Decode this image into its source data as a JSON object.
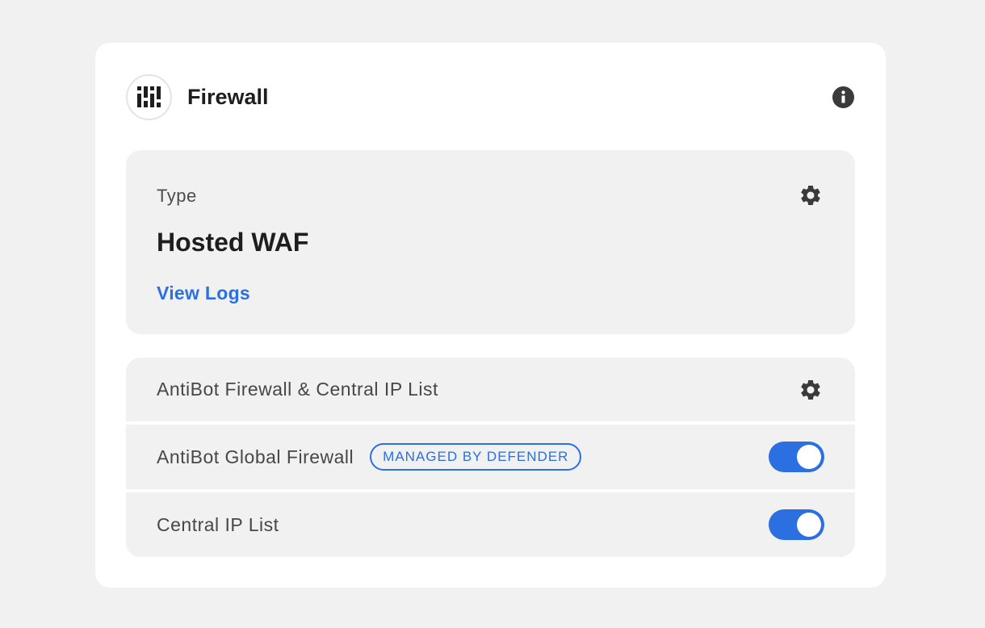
{
  "header": {
    "title": "Firewall",
    "logo_icon": "bars-logo-icon",
    "info_icon": "info-icon"
  },
  "type_panel": {
    "label": "Type",
    "value": "Hosted WAF",
    "link": "View Logs",
    "settings_icon": "gear-icon"
  },
  "list": {
    "header_label": "AntiBot Firewall & Central IP List",
    "header_icon": "gear-icon",
    "items": [
      {
        "label": "AntiBot Global Firewall",
        "badge": "MANAGED BY DEFENDER",
        "enabled": true
      },
      {
        "label": "Central IP List",
        "enabled": true
      }
    ]
  },
  "colors": {
    "accent": "#2b6fe0",
    "panel_bg": "#f1f1f1",
    "card_bg": "#ffffff",
    "icon": "#3a3a3a"
  }
}
